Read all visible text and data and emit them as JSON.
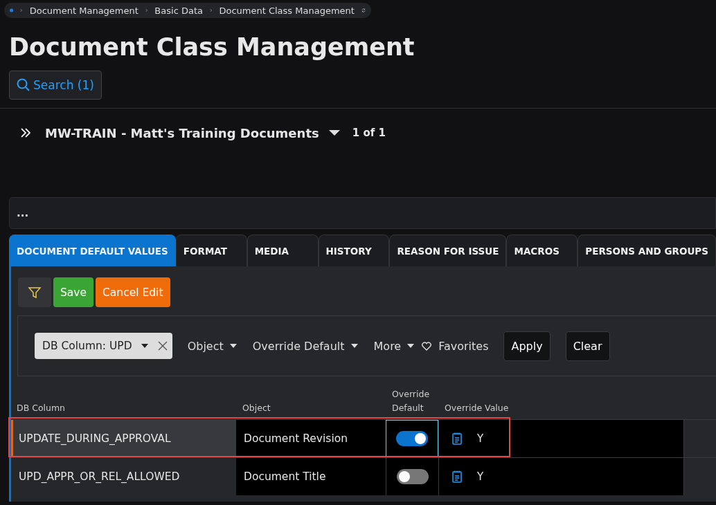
{
  "breadcrumb": [
    "Document Management",
    "Basic Data",
    "Document Class Management"
  ],
  "title": "Document Class Management",
  "search_button": "Search (1)",
  "record": {
    "title": "MW-TRAIN - Matt's Training Documents",
    "counter": "1 of 1"
  },
  "summary_bar": "...",
  "tabs": [
    {
      "label": "DOCUMENT DEFAULT VALUES",
      "selected": true
    },
    {
      "label": "FORMAT",
      "selected": false
    },
    {
      "label": "MEDIA",
      "selected": false
    },
    {
      "label": "HISTORY",
      "selected": false
    },
    {
      "label": "REASON FOR ISSUE",
      "selected": false
    },
    {
      "label": "MACROS",
      "selected": false
    },
    {
      "label": "PERSONS AND GROUPS",
      "selected": false
    }
  ],
  "toolbar": {
    "save": "Save",
    "cancel": "Cancel Edit"
  },
  "filters": {
    "chip": "DB Column: UPD",
    "dropdowns": [
      "Object",
      "Override Default",
      "More"
    ],
    "favorites": "Favorites",
    "apply": "Apply",
    "clear": "Clear"
  },
  "table": {
    "columns": [
      "DB Column",
      "Object",
      "Override\nDefault",
      "Override Value"
    ],
    "rows": [
      {
        "db_column": "UPDATE_DURING_APPROVAL",
        "object": "Document Revision",
        "override_default": true,
        "override_value": "Y",
        "selected": true,
        "annotated": true
      },
      {
        "db_column": "UPD_APPR_OR_REL_ALLOWED",
        "object": "Document Title",
        "override_default": false,
        "override_value": "Y",
        "selected": false,
        "annotated": false
      }
    ]
  }
}
